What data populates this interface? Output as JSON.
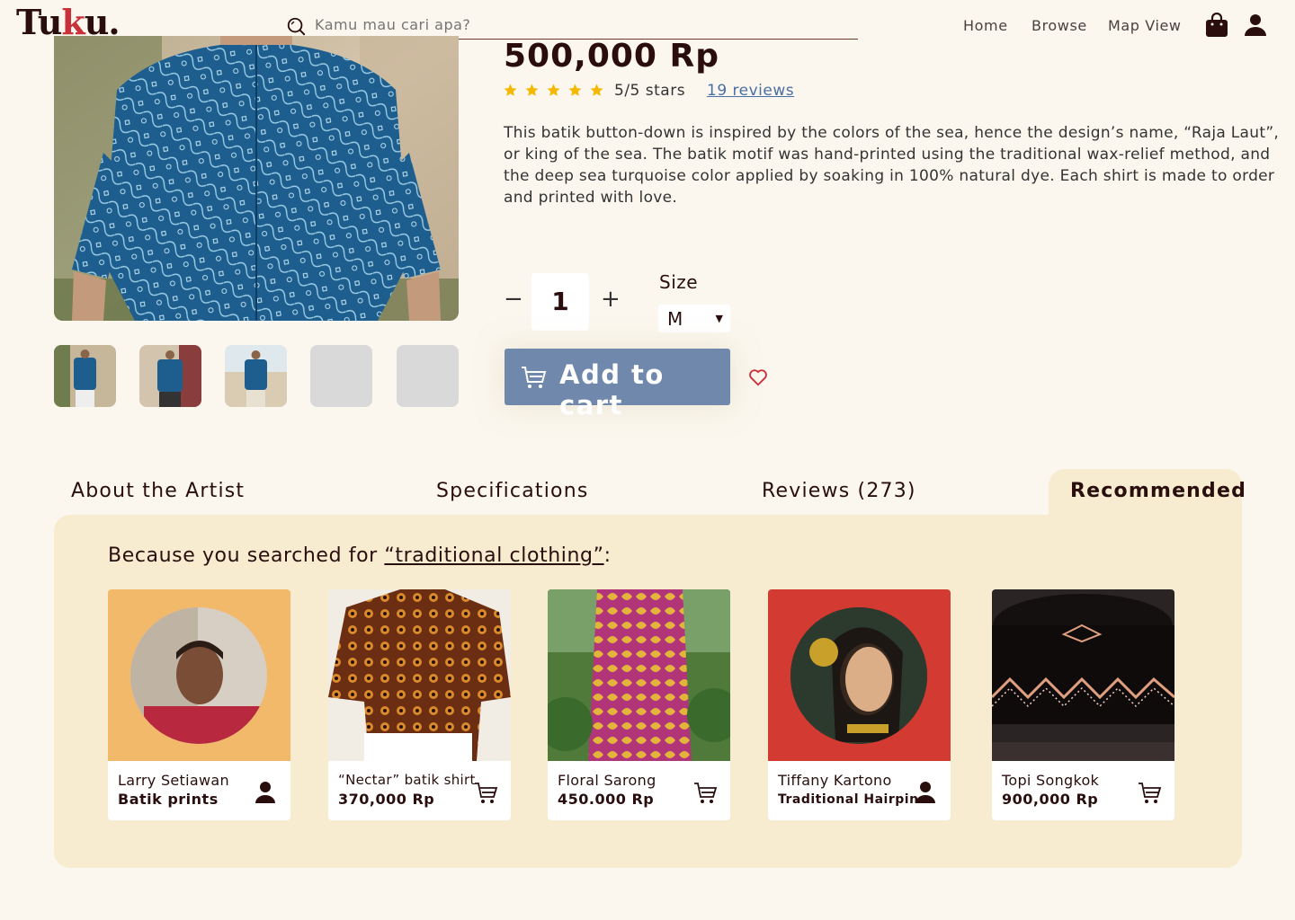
{
  "header": {
    "logo": {
      "pre": "Tu",
      "mid": "k",
      "post": "u."
    },
    "search_placeholder": "Kamu mau cari apa?",
    "nav": [
      "Home",
      "Browse",
      "Map View"
    ]
  },
  "product": {
    "price": "500,000 Rp",
    "rating_stars": 5,
    "rating_text": "5/5 stars",
    "reviews_link": "19 reviews",
    "description": "This batik button-down is inspired by the colors of the sea, hence the design’s name, “Raja Laut”, or king of the sea. The batik motif was hand-printed using the traditional wax-relief method, and the deep sea turquoise color applied by soaking in 100% natural dye. Each shirt is made to order and printed with love.",
    "quantity": "1",
    "qty_minus": "−",
    "qty_plus": "+",
    "size_label": "Size",
    "size_value": "M",
    "add_to_cart": "Add to cart"
  },
  "tabs": [
    "About the Artist",
    "Specifications",
    "Reviews (273)",
    "Recommended"
  ],
  "recommended": {
    "intro": "Because you searched for ",
    "query": "“traditional clothing”",
    "suffix": ":",
    "cards": [
      {
        "line1": "Larry Setiawan",
        "line2": "Batik prints",
        "icon": "person-icon"
      },
      {
        "line1": "“Nectar” batik shirt",
        "line2": "370,000 Rp",
        "icon": "cart-icon"
      },
      {
        "line1": "Floral Sarong",
        "line2": "450.000 Rp",
        "icon": "cart-icon"
      },
      {
        "line1": "Tiffany Kartono",
        "line2": "Traditional Hairpins",
        "icon": "person-icon"
      },
      {
        "line1": "Topi Songkok",
        "line2": "900,000 Rp",
        "icon": "cart-icon"
      }
    ]
  },
  "colors": {
    "background": "#fbf7ee",
    "panel": "#f7ecd0",
    "button": "#7088ab",
    "star": "#f5b800",
    "brand_red": "#c8313a",
    "dark": "#2a0e0e"
  }
}
